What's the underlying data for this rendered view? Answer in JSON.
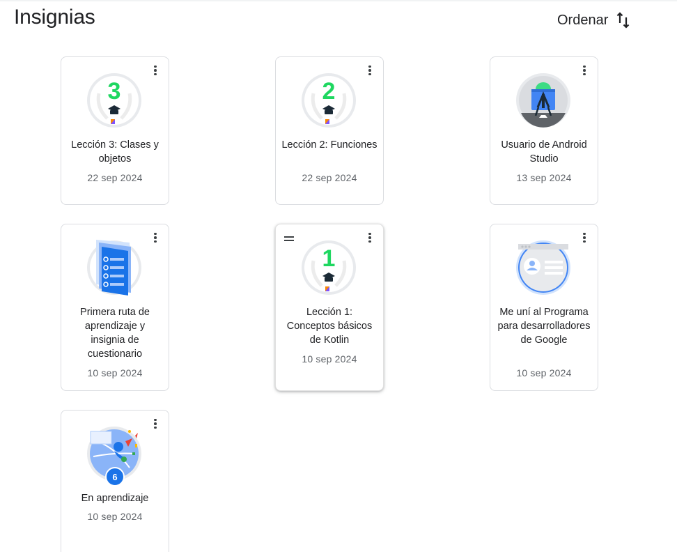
{
  "header": {
    "title": "Insignias",
    "sort_label": "Ordenar",
    "sort_icon": "sort-arrows-icon"
  },
  "badges": [
    {
      "title": "Lección 3: Clases y objetos",
      "date": "22 sep 2024",
      "number": "3",
      "icon": "kotlin-lesson-badge-icon"
    },
    {
      "title": "Lección 2: Funciones",
      "date": "22 sep 2024",
      "number": "2",
      "icon": "kotlin-lesson-badge-icon"
    },
    {
      "title": "Usuario de Android Studio",
      "date": "13 sep 2024",
      "icon": "android-studio-badge-icon"
    },
    {
      "title": "Primera ruta de aprendizaje y insignia de cuestionario",
      "date": "10 sep 2024",
      "icon": "quiz-pathway-badge-icon"
    },
    {
      "title": "Lección 1: Conceptos básicos de Kotlin",
      "date": "10 sep 2024",
      "number": "1",
      "icon": "kotlin-lesson-badge-icon"
    },
    {
      "title": "Me uní al Programa para desarrolladores de Google",
      "date": "10 sep 2024",
      "icon": "developer-profile-badge-icon"
    },
    {
      "title": "En aprendizaje",
      "date": "10 sep 2024",
      "count": "6",
      "icon": "learning-globe-badge-icon"
    }
  ],
  "colors": {
    "lesson_number": "#1ed760",
    "accent_blue": "#1a73e8",
    "card_border": "#dadce0",
    "date_text": "#5f6368"
  }
}
